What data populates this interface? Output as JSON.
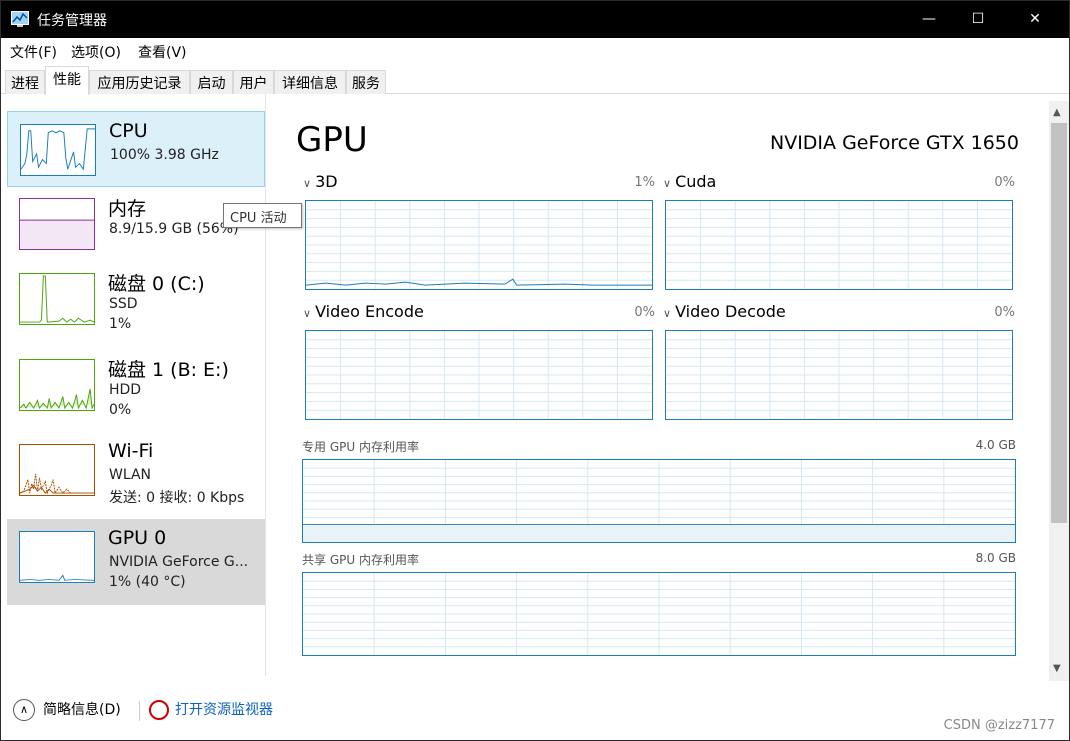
{
  "window": {
    "title": "任务管理器"
  },
  "menu": {
    "file": "文件(F)",
    "options": "选项(O)",
    "view": "查看(V)"
  },
  "tabs": [
    "进程",
    "性能",
    "应用历史记录",
    "启动",
    "用户",
    "详细信息",
    "服务"
  ],
  "sidebar": {
    "cpu": {
      "name": "CPU",
      "line2": "100% 3.98 GHz"
    },
    "memory": {
      "name": "内存",
      "line2": "8.9/15.9 GB (56%)"
    },
    "disk0": {
      "name": "磁盘 0 (C:)",
      "line2": "SSD",
      "line3": "1%"
    },
    "disk1": {
      "name": "磁盘 1 (B: E:)",
      "line2": "HDD",
      "line3": "0%"
    },
    "wifi": {
      "name": "Wi-Fi",
      "line2": "WLAN",
      "line3": "发送: 0 接收: 0 Kbps"
    },
    "gpu": {
      "name": "GPU 0",
      "line2": "NVIDIA GeForce G...",
      "line3": "1% (40 °C)"
    }
  },
  "tooltip": "CPU 活动",
  "main": {
    "title": "GPU",
    "model": "NVIDIA GeForce GTX 1650",
    "engines": [
      {
        "label": "3D",
        "percent": "1%"
      },
      {
        "label": "Cuda",
        "percent": "0%"
      },
      {
        "label": "Video Encode",
        "percent": "0%"
      },
      {
        "label": "Video Decode",
        "percent": "0%"
      }
    ],
    "dedicated": {
      "label": "专用 GPU 内存利用率",
      "max": "4.0 GB"
    },
    "shared": {
      "label": "共享 GPU 内存利用率",
      "max": "8.0 GB"
    }
  },
  "footer": {
    "details": "简略信息(D)",
    "monitor": "打开资源监视器"
  },
  "watermark": "CSDN @zizz7177",
  "colors": {
    "cpu": "#1b7eb8",
    "memory": "#8b2f9e",
    "disk": "#4da60c",
    "wifi": "#a74f01",
    "gpu": "#1b7eb8"
  }
}
